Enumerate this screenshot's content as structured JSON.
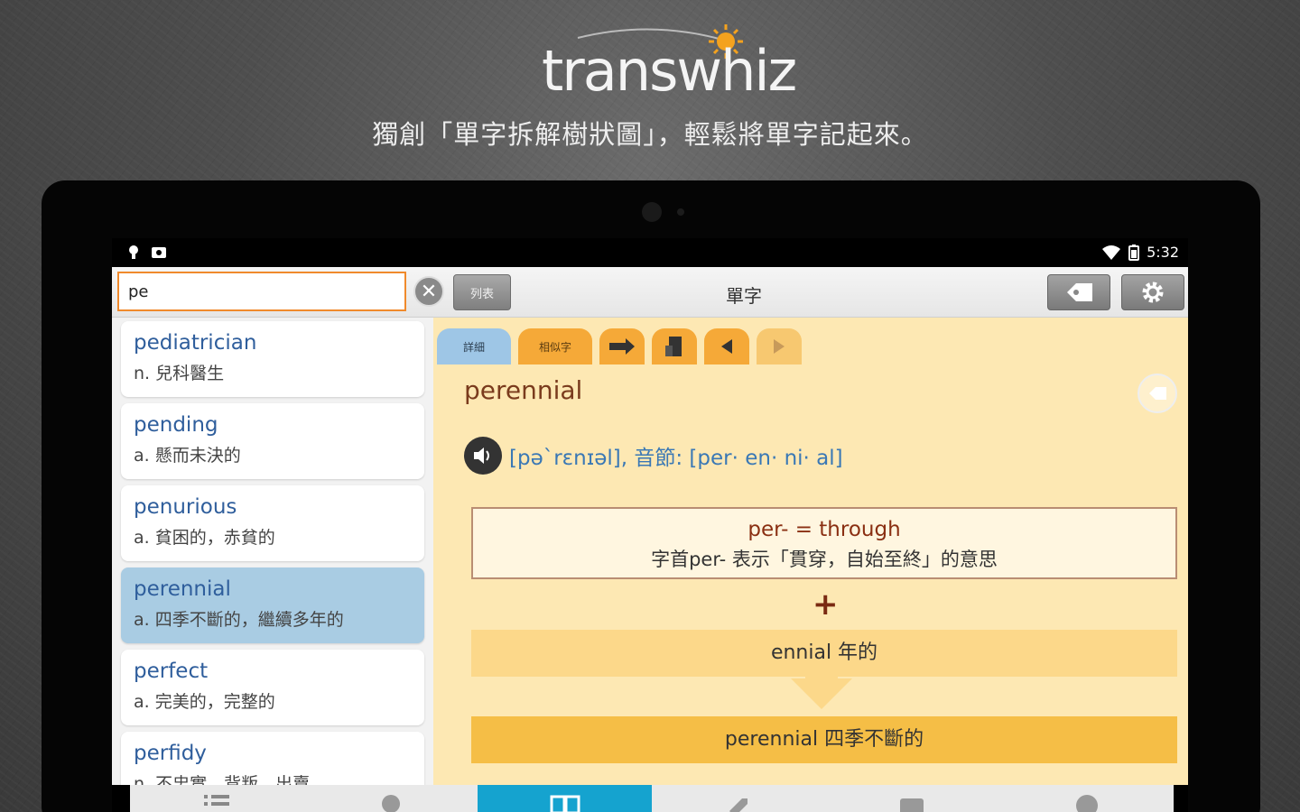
{
  "header": {
    "logo_text": "transwhiz",
    "tagline": "獨創「單字拆解樹狀圖」，輕鬆將單字記起來。"
  },
  "statusbar": {
    "time": "5:32",
    "left_icons": [
      "notification-icon",
      "photo-icon"
    ],
    "right_icons": [
      "wifi-icon",
      "battery-icon"
    ]
  },
  "toolbar": {
    "search_value": "pe",
    "clear_label": "✕",
    "list_button": "列表",
    "title": "單字",
    "tag_button_icon": "tag-icon",
    "settings_button_icon": "gear-icon"
  },
  "word_list": [
    {
      "word": "pediatrician",
      "def": "n. 兒科醫生"
    },
    {
      "word": "pending",
      "def": "a. 懸而未決的"
    },
    {
      "word": "penurious",
      "def": "a. 貧困的，赤貧的"
    },
    {
      "word": "perennial",
      "def": "a. 四季不斷的，繼續多年的",
      "selected": true
    },
    {
      "word": "perfect",
      "def": "a. 完美的，完整的"
    },
    {
      "word": "perfidy",
      "def": "n. 不忠實，背叛，出賣"
    }
  ],
  "detail": {
    "tabs": [
      "詳細",
      "相似字"
    ],
    "tab_icons": [
      "swap-icon",
      "book-icon",
      "prev-arrow-icon",
      "next-arrow-icon"
    ],
    "word": "perennial",
    "phonetic": "[pə`rɛnɪəl], 音節: [per· en· ni· al]",
    "prefix_title": "per- = through",
    "prefix_desc": "字首per- 表示「貫穿，自始至終」的意思",
    "plus": "+",
    "root": "ennial 年的",
    "result": "perennial 四季不斷的"
  },
  "bottom_nav": [
    {
      "icon": "list-icon",
      "active": false
    },
    {
      "icon": "head-icon",
      "active": false
    },
    {
      "icon": "book-open-icon",
      "active": true
    },
    {
      "icon": "tag-icon",
      "active": false
    },
    {
      "icon": "flashcard-icon",
      "active": false
    },
    {
      "icon": "info-icon",
      "active": false
    }
  ],
  "colors": {
    "accent_orange": "#f08a2c",
    "selected_item": "#a9cce3",
    "active_nav": "#15a3cf",
    "detail_bg": "#fde8b3"
  }
}
